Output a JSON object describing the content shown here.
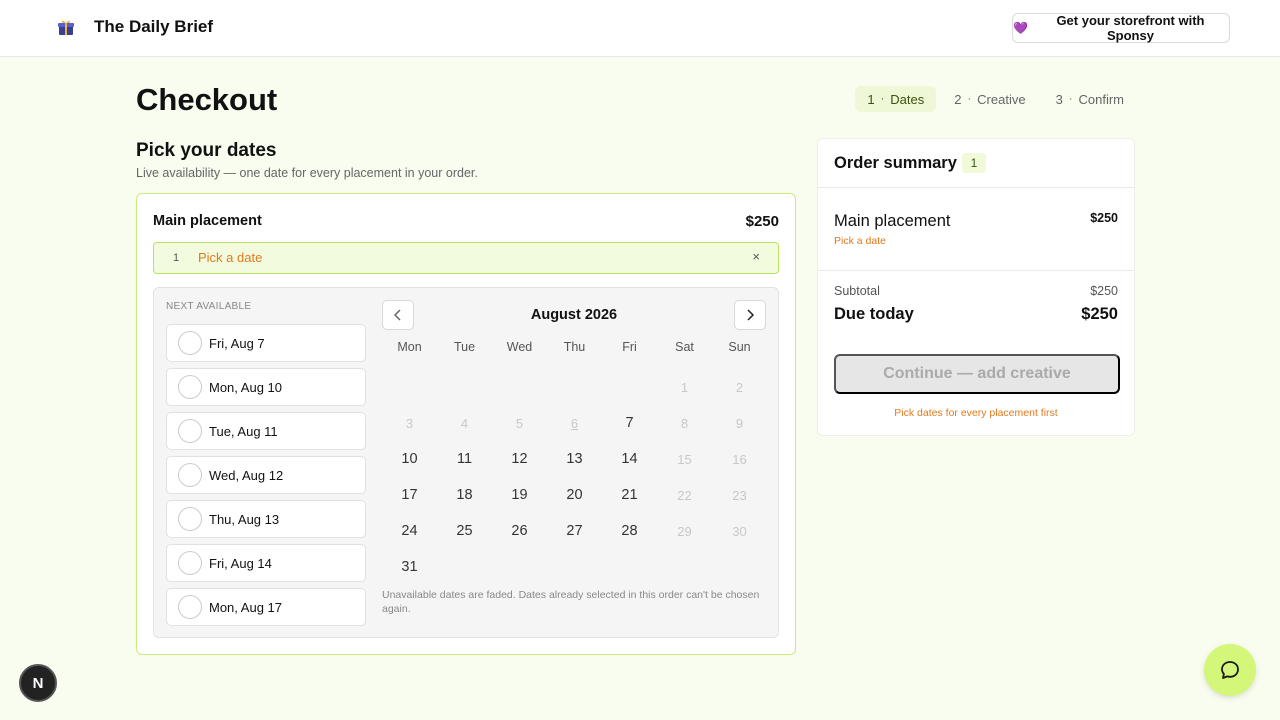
{
  "header": {
    "logo_icon": "gift-box-icon",
    "brand_name": "The Daily Brief",
    "sponsy_button": {
      "icon": "purple-heart",
      "emoji": "💜",
      "label": "Get your storefront with Sponsy"
    }
  },
  "page": {
    "title": "Checkout"
  },
  "steps": [
    {
      "num": "1",
      "sep": "·",
      "label": "Dates",
      "active": true
    },
    {
      "num": "2",
      "sep": "·",
      "label": "Creative",
      "active": false
    },
    {
      "num": "3",
      "sep": "·",
      "label": "Confirm",
      "active": false
    }
  ],
  "dates_section": {
    "title": "Pick your dates",
    "subtitle": "Live availability — one date for every placement in your order."
  },
  "placement": {
    "name": "Main placement",
    "price": "$250",
    "slot": {
      "number": "1",
      "text": "Pick a date",
      "close": "×"
    }
  },
  "next_available": {
    "label": "NEXT AVAILABLE",
    "items": [
      "Fri, Aug 7",
      "Mon, Aug 10",
      "Tue, Aug 11",
      "Wed, Aug 12",
      "Thu, Aug 13",
      "Fri, Aug 14",
      "Mon, Aug 17"
    ]
  },
  "calendar": {
    "month": "August 2026",
    "weekdays": [
      "Mon",
      "Tue",
      "Wed",
      "Thu",
      "Fri",
      "Sat",
      "Sun"
    ],
    "leading_blanks": 5,
    "days": [
      {
        "d": "1",
        "s": "faded"
      },
      {
        "d": "2",
        "s": "faded"
      },
      {
        "d": "3",
        "s": "faded"
      },
      {
        "d": "4",
        "s": "faded"
      },
      {
        "d": "5",
        "s": "faded"
      },
      {
        "d": "6",
        "s": "taken"
      },
      {
        "d": "7",
        "s": "avail"
      },
      {
        "d": "8",
        "s": "faded"
      },
      {
        "d": "9",
        "s": "faded"
      },
      {
        "d": "10",
        "s": "avail"
      },
      {
        "d": "11",
        "s": "avail"
      },
      {
        "d": "12",
        "s": "avail"
      },
      {
        "d": "13",
        "s": "avail"
      },
      {
        "d": "14",
        "s": "avail"
      },
      {
        "d": "15",
        "s": "faded"
      },
      {
        "d": "16",
        "s": "faded"
      },
      {
        "d": "17",
        "s": "avail"
      },
      {
        "d": "18",
        "s": "avail"
      },
      {
        "d": "19",
        "s": "avail"
      },
      {
        "d": "20",
        "s": "avail"
      },
      {
        "d": "21",
        "s": "avail"
      },
      {
        "d": "22",
        "s": "faded"
      },
      {
        "d": "23",
        "s": "faded"
      },
      {
        "d": "24",
        "s": "avail"
      },
      {
        "d": "25",
        "s": "avail"
      },
      {
        "d": "26",
        "s": "avail"
      },
      {
        "d": "27",
        "s": "avail"
      },
      {
        "d": "28",
        "s": "avail"
      },
      {
        "d": "29",
        "s": "faded"
      },
      {
        "d": "30",
        "s": "faded"
      },
      {
        "d": "31",
        "s": "avail"
      }
    ],
    "note": "Unavailable dates are faded. Dates already selected in this order can't be chosen again."
  },
  "summary": {
    "title": "Order summary",
    "count": "1",
    "item_name": "Main placement",
    "item_price": "$250",
    "item_status": "Pick a date",
    "subtotal_label": "Subtotal",
    "subtotal_value": "$250",
    "due_label": "Due today",
    "due_value": "$250",
    "continue_label": "Continue — add creative",
    "hint": "Pick dates for every placement first"
  },
  "widgets": {
    "next_badge": "N",
    "chat_icon": "chat-bubble-icon"
  },
  "colors": {
    "accent": "#c8ee7a",
    "warning": "#e07b1f",
    "chat": "#d4f77a",
    "page_bg": "#f8fdef"
  }
}
